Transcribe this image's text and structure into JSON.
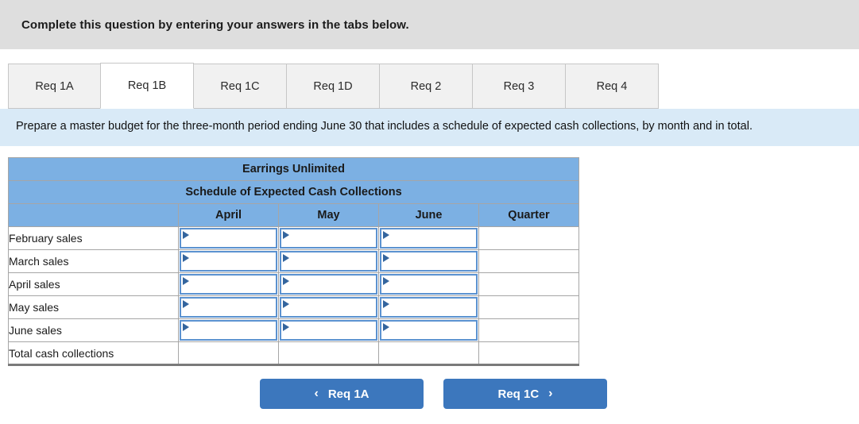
{
  "banner": {
    "text": "Complete this question by entering your answers in the tabs below."
  },
  "tabs": {
    "active": "Req 1B",
    "items": [
      {
        "label": "Req 1A",
        "active": false
      },
      {
        "label": "Req 1B",
        "active": true
      },
      {
        "label": "Req 1C",
        "active": false
      },
      {
        "label": "Req 1D",
        "active": false
      },
      {
        "label": "Req 2",
        "active": false
      },
      {
        "label": "Req 3",
        "active": false
      },
      {
        "label": "Req 4",
        "active": false
      }
    ]
  },
  "requirement": {
    "text": "Prepare a master budget for the three-month period ending June 30 that includes a schedule of expected cash collections, by month and in total."
  },
  "worksheet": {
    "company": "Earrings Unlimited",
    "title": "Schedule of Expected Cash Collections",
    "columns": [
      "",
      "April",
      "May",
      "June",
      "Quarter"
    ],
    "rows": [
      {
        "label": "February sales",
        "april": "",
        "may": "",
        "june": "",
        "quarter": "",
        "editable": true
      },
      {
        "label": "March sales",
        "april": "",
        "may": "",
        "june": "",
        "quarter": "",
        "editable": true
      },
      {
        "label": "April sales",
        "april": "",
        "may": "",
        "june": "",
        "quarter": "",
        "editable": true
      },
      {
        "label": "May sales",
        "april": "",
        "may": "",
        "june": "",
        "quarter": "",
        "editable": true
      },
      {
        "label": "June sales",
        "april": "",
        "may": "",
        "june": "",
        "quarter": "",
        "editable": true
      },
      {
        "label": "Total cash collections",
        "april": "",
        "may": "",
        "june": "",
        "quarter": "",
        "editable": false
      }
    ]
  },
  "nav": {
    "prev_label": "Req 1A",
    "next_label": "Req 1C",
    "prev_icon": "chevron-left-icon",
    "next_icon": "chevron-right-icon",
    "prev_glyph": "‹",
    "next_glyph": "›"
  },
  "colors": {
    "banner_bg": "#dedede",
    "req_band_bg": "#d9eaf7",
    "table_header_blue": "#7cb0e3",
    "button_blue": "#3c77bd",
    "input_border_blue": "#5b92d0",
    "cell_marker_blue": "#34659e"
  }
}
